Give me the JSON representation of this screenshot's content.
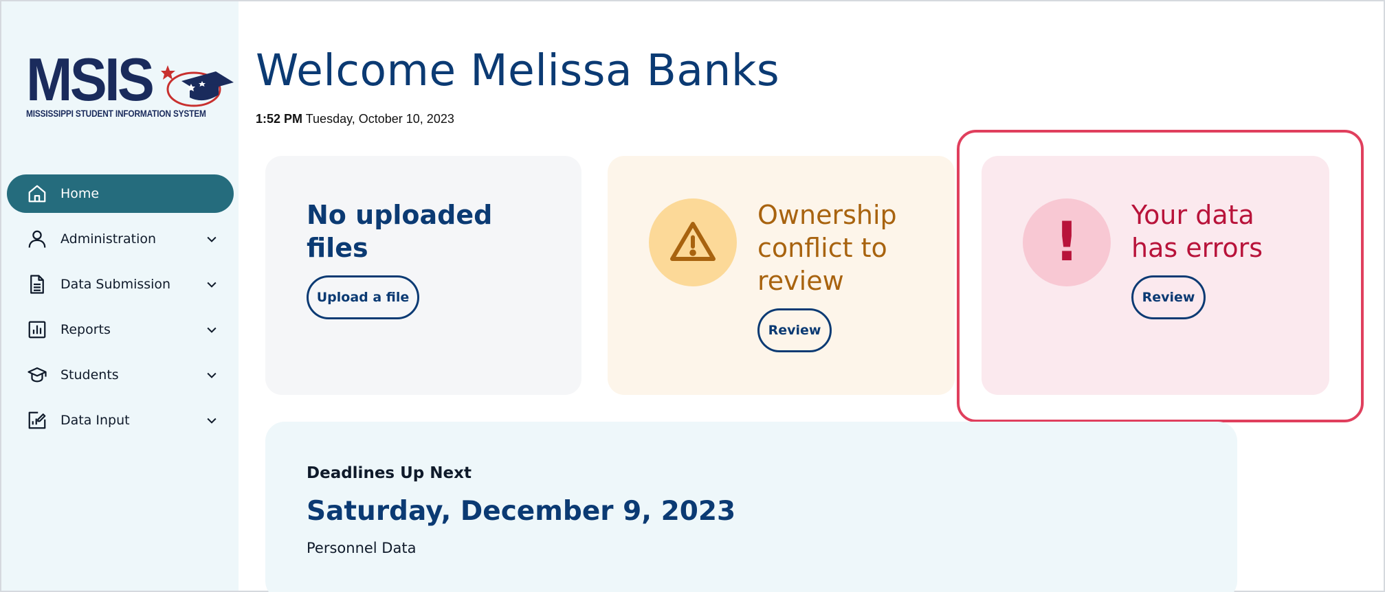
{
  "logo": {
    "title": "MSIS",
    "subtitle": "MISSISSIPPI STUDENT INFORMATION SYSTEM"
  },
  "sidebar": {
    "items": [
      {
        "label": "Home",
        "icon": "home-icon",
        "active": true,
        "expandable": false
      },
      {
        "label": "Administration",
        "icon": "user-icon",
        "active": false,
        "expandable": true
      },
      {
        "label": "Data Submission",
        "icon": "document-icon",
        "active": false,
        "expandable": true
      },
      {
        "label": "Reports",
        "icon": "bar-chart-icon",
        "active": false,
        "expandable": true
      },
      {
        "label": "Students",
        "icon": "graduation-cap-icon",
        "active": false,
        "expandable": true
      },
      {
        "label": "Data Input",
        "icon": "edit-chart-icon",
        "active": false,
        "expandable": true
      }
    ]
  },
  "header": {
    "welcome": "Welcome Melissa Banks",
    "time": "1:52 PM",
    "date": "Tuesday, October 10, 2023"
  },
  "cards": {
    "uploads": {
      "title": "No uploaded files",
      "button": "Upload a file"
    },
    "ownership": {
      "title": "Ownership conflict to review",
      "button": "Review",
      "icon": "warning-icon"
    },
    "errors": {
      "title": "Your data has errors",
      "button": "Review",
      "icon": "exclamation-icon",
      "symbol": "!"
    }
  },
  "deadlines": {
    "label": "Deadlines Up Next",
    "date": "Saturday, December 9, 2023",
    "item": "Personnel Data"
  },
  "colors": {
    "primary": "#0b3a73",
    "sidebar_active": "#256c7d",
    "warning": "#a8630f",
    "error": "#b8133a",
    "highlight": "#e03f5d"
  }
}
